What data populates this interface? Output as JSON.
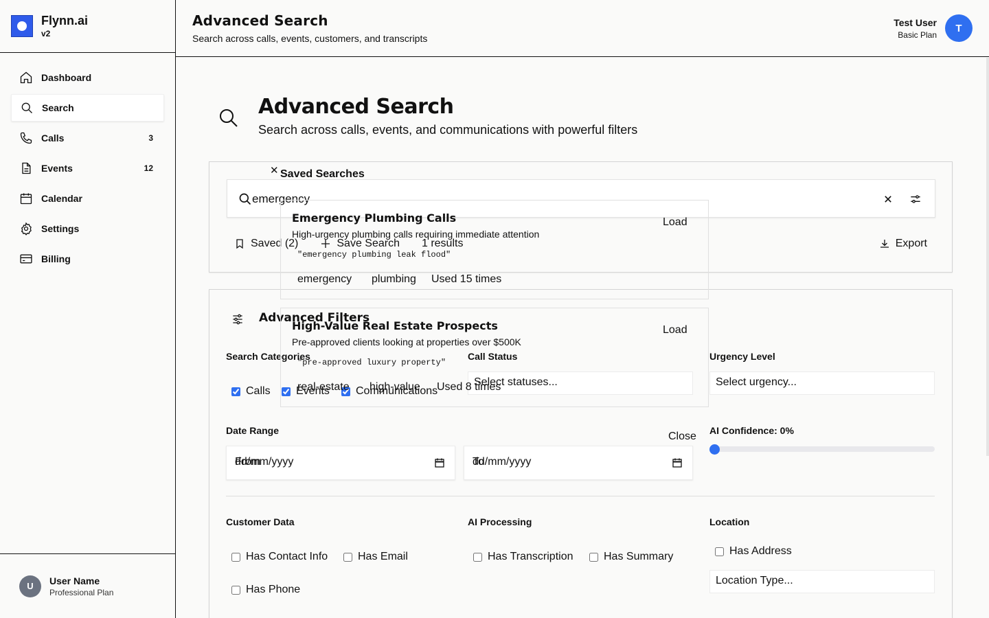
{
  "brand": {
    "name": "Flynn.ai",
    "version": "v2"
  },
  "sidebar": {
    "items": [
      {
        "label": "Dashboard",
        "count": ""
      },
      {
        "label": "Search",
        "count": ""
      },
      {
        "label": "Calls",
        "count": "3"
      },
      {
        "label": "Events",
        "count": "12"
      },
      {
        "label": "Calendar",
        "count": ""
      },
      {
        "label": "Settings",
        "count": ""
      },
      {
        "label": "Billing",
        "count": ""
      }
    ],
    "user": {
      "initial": "U",
      "name": "User Name",
      "plan": "Professional Plan"
    }
  },
  "header": {
    "title": "Advanced Search",
    "subtitle": "Search across calls, events, customers, and transcripts",
    "user": {
      "name": "Test User",
      "plan": "Basic Plan",
      "initial": "T"
    }
  },
  "hero": {
    "title": "Advanced Search",
    "subtitle": "Search across calls, events, and communications with powerful filters"
  },
  "search": {
    "query": "emergency",
    "saved_label": "Saved (2)",
    "save_label": "Save Search",
    "results_label": "1 results",
    "export_label": "Export"
  },
  "filters": {
    "title": "Advanced Filters",
    "categories_label": "Search Categories",
    "categories": [
      {
        "label": "Calls",
        "checked": true
      },
      {
        "label": "Events",
        "checked": true
      },
      {
        "label": "Communications",
        "checked": true
      }
    ],
    "call_status_label": "Call Status",
    "call_status_placeholder": "Select statuses...",
    "urgency_label": "Urgency Level",
    "urgency_placeholder": "Select urgency...",
    "date_range_label": "Date Range",
    "date_from_prefix": "From",
    "date_to_prefix": "To",
    "date_placeholder": "dd/mm/yyyy",
    "ai_confidence_label": "AI Confidence: 0%",
    "ai_confidence_value": 0,
    "customer_data_label": "Customer Data",
    "customer_data": [
      "Has Contact Info",
      "Has Email",
      "Has Phone"
    ],
    "ai_processing_label": "AI Processing",
    "ai_processing": [
      "Has Transcription",
      "Has Summary"
    ],
    "location_label": "Location",
    "location_has_address": "Has Address",
    "location_type_placeholder": "Location Type..."
  },
  "saved_searches": {
    "title": "Saved Searches",
    "close_label": "Close",
    "load_label": "Load",
    "items": [
      {
        "name": "Emergency Plumbing Calls",
        "description": "High-urgency plumbing calls requiring immediate attention",
        "query": "\"emergency plumbing leak flood\"",
        "tags": [
          "emergency",
          "plumbing"
        ],
        "usage": "Used 15 times"
      },
      {
        "name": "High-Value Real Estate Prospects",
        "description": "Pre-approved clients looking at properties over $500K",
        "query": "\"pre-approved luxury property\"",
        "tags": [
          "real-estate",
          "high-value"
        ],
        "usage": "Used 8 times"
      }
    ]
  },
  "colors": {
    "accent": "#2f6ff0",
    "brand": "#2f5bea"
  }
}
